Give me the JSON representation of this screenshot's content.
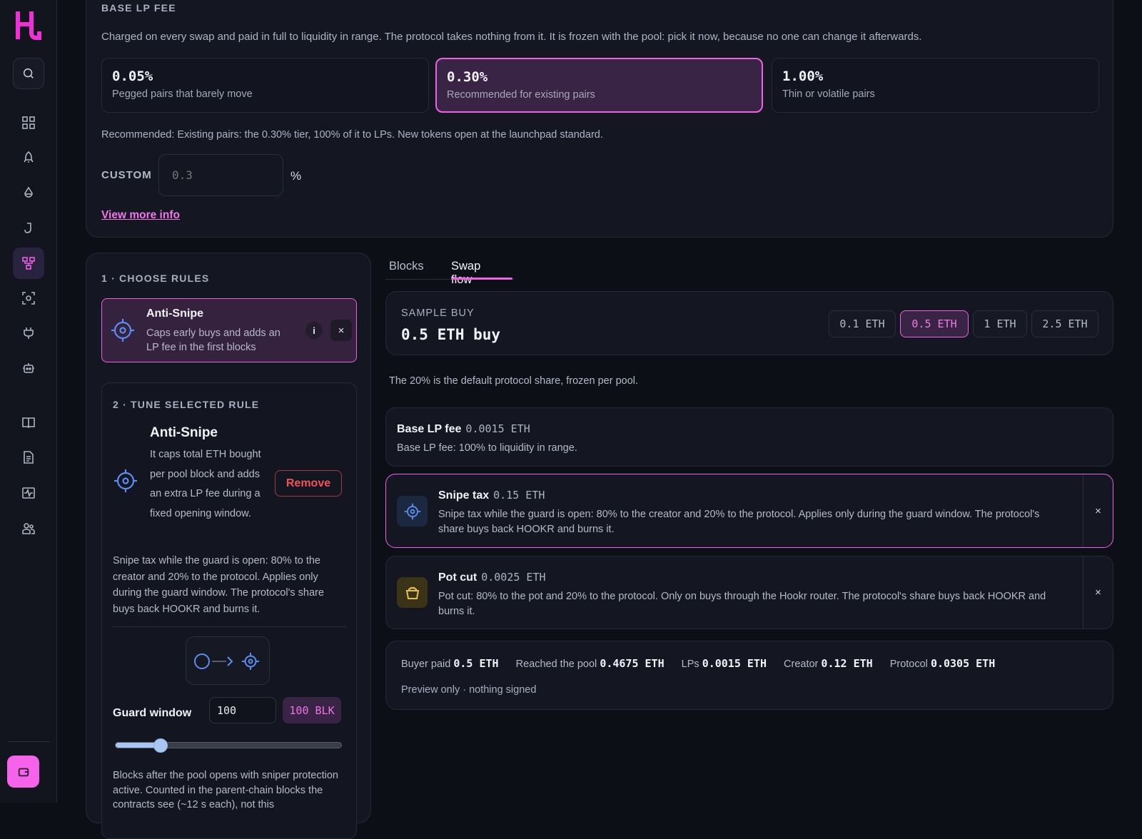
{
  "colors": {
    "accent": "#ef62e8",
    "danger": "#f0545a",
    "bg": "#0d0f16",
    "panel": "#141722",
    "guard_blue": "#5b8ef0",
    "pot_yellow": "#e8c14a"
  },
  "sidebar": {
    "logo": "H",
    "items": [
      {
        "icon": "grid-icon"
      },
      {
        "icon": "rocket-icon"
      },
      {
        "icon": "droplet-icon"
      },
      {
        "icon": "hook-icon"
      },
      {
        "icon": "hierarchy-icon",
        "active": true
      },
      {
        "icon": "scan-icon"
      },
      {
        "icon": "plug-icon"
      },
      {
        "icon": "robot-icon"
      },
      {
        "icon": "book-icon"
      },
      {
        "icon": "document-icon"
      },
      {
        "icon": "activity-icon"
      },
      {
        "icon": "users-icon"
      }
    ]
  },
  "base_fee": {
    "title": "BASE LP FEE",
    "description": "Charged on every swap and paid in full to liquidity in range. The protocol takes nothing from it. It is frozen with the pool: pick it now, because no one can change it afterwards.",
    "tiers": [
      {
        "pct": "0.05%",
        "sub": "Pegged pairs that barely move"
      },
      {
        "pct": "0.30%",
        "sub": "Recommended for existing pairs",
        "selected": true
      },
      {
        "pct": "1.00%",
        "sub": "Thin or volatile pairs"
      }
    ],
    "recommendation": "Recommended: Existing pairs: the 0.30% tier, 100% of it to LPs. New tokens open at the launchpad standard.",
    "custom_label": "CUSTOM",
    "custom_placeholder": "0.3",
    "custom_unit": "%",
    "more_link": "View more info"
  },
  "rules": {
    "title": "1 · CHOOSE RULES",
    "chip": {
      "name": "Anti-Snipe",
      "desc": "Caps early buys and adds an LP fee in the first blocks",
      "info": "i",
      "close": "×"
    },
    "tune": {
      "title": "2 · TUNE SELECTED RULE",
      "name": "Anti-Snipe",
      "desc": "It caps total ETH bought per pool block and adds an extra LP fee during a fixed opening window.",
      "remove": "Remove",
      "note": "Snipe tax while the guard is open: 80% to the creator and 20% to the protocol. Applies only during the guard window. The protocol's share buys back HOOKR and burns it.",
      "guard_label": "Guard window",
      "guard_value": "100",
      "guard_badge": "100 BLK",
      "slider_fraction": 0.2,
      "guard_note": "Blocks after the pool opens with sniper protection active. Counted in the parent-chain blocks the contracts see (~12 s each), not this"
    }
  },
  "tabs": [
    {
      "label": "Blocks"
    },
    {
      "label": "Swap flow",
      "active": true
    }
  ],
  "sample": {
    "label": "SAMPLE BUY",
    "value": "0.5 ETH buy",
    "amounts": [
      {
        "label": "0.1 ETH"
      },
      {
        "label": "0.5 ETH",
        "selected": true
      },
      {
        "label": "1 ETH"
      },
      {
        "label": "2.5 ETH"
      }
    ]
  },
  "share_note": "The 20% is the default protocol share, frozen per pool.",
  "flow": [
    {
      "title": "Base LP fee",
      "amount": "0.0015 ETH",
      "text": "Base LP fee: 100% to liquidity in range."
    },
    {
      "title": "Snipe tax",
      "amount": "0.15 ETH",
      "text": "Snipe tax while the guard is open: 80% to the creator and 20% to the protocol. Applies only during the guard window. The protocol's share buys back HOOKR and burns it.",
      "icon": "crosshair-icon",
      "close": "×"
    },
    {
      "title": "Pot cut",
      "amount": "0.0025 ETH",
      "text": "Pot cut: 80% to the pot and 20% to the protocol. Only on buys through the Hookr router. The protocol's share buys back HOOKR and burns it.",
      "icon": "pot-icon",
      "close": "×"
    }
  ],
  "summary": {
    "buyer_label": "Buyer paid",
    "buyer_value": "0.5 ETH",
    "pool_label": "Reached the pool",
    "pool_value": "0.4675 ETH",
    "lps_label": "LPs",
    "lps_value": "0.0015 ETH",
    "creator_label": "Creator",
    "creator_value": "0.12 ETH",
    "protocol_label": "Protocol",
    "protocol_value": "0.0305 ETH",
    "preview": "Preview only · nothing signed"
  }
}
